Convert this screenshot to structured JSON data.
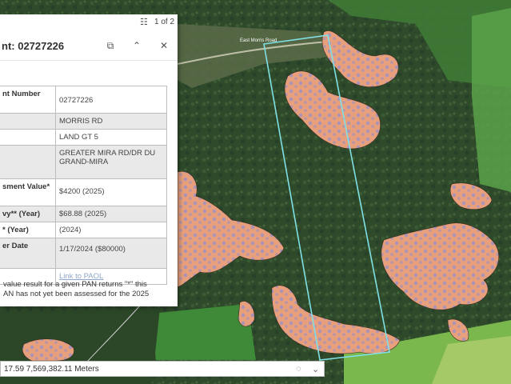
{
  "pager": {
    "text": "1 of 2",
    "icon": "list-icon"
  },
  "popup": {
    "title": "nt: 02727226",
    "dock_icon": "dock-icon",
    "collapse_icon": "chevron-up-icon",
    "close_icon": "close-icon",
    "rows": [
      {
        "label": "nt Number",
        "value": "02727226"
      },
      {
        "label": "",
        "value": "MORRIS RD"
      },
      {
        "label": "",
        "value": "LAND GT 5"
      },
      {
        "label": "",
        "value": "GREATER MIRA RD/DR DU GRAND-MIRA"
      },
      {
        "label": "sment Value*",
        "value": "$4200 (2025)"
      },
      {
        "label": "vy** (Year)",
        "value": "$68.88 (2025)"
      },
      {
        "label": "* (Year)",
        "value": "(2024)"
      },
      {
        "label": "er Date",
        "value": "1/17/2024 ($80000)"
      },
      {
        "label": "",
        "value": "Link to PAOL"
      }
    ],
    "footnote_lines": [
      "value result for a given PAN returns \"*\" this",
      "AN has not yet been assessed for the 2025"
    ]
  },
  "coords": {
    "text": "17.59 7,569,382.11 Meters",
    "accent": "#2a7ad4"
  },
  "map": {
    "road_label": "East Morris Road"
  },
  "colors": {
    "parcel_outline": "#7fe0e6",
    "wetland": "#e8a07c",
    "wetland_dot": "#9a8fc8"
  }
}
